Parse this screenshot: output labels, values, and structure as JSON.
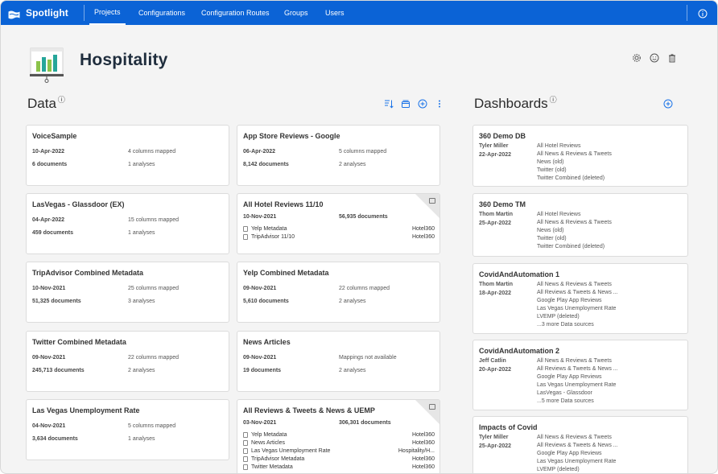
{
  "app": {
    "name": "Spotlight"
  },
  "nav": {
    "items": [
      {
        "label": "Projects",
        "active": true
      },
      {
        "label": "Configurations",
        "active": false
      },
      {
        "label": "Configuration Routes",
        "active": false
      },
      {
        "label": "Groups",
        "active": false
      },
      {
        "label": "Users",
        "active": false
      }
    ]
  },
  "project": {
    "title": "Hospitality"
  },
  "data_section": {
    "title": "Data",
    "info_mark": "ⓘ",
    "cards": [
      {
        "title": "VoiceSample",
        "date": "10-Apr-2022",
        "docs": "6 documents",
        "mapped": "4 columns mapped",
        "analyses": "1 analyses"
      },
      {
        "title": "App Store Reviews - Google",
        "date": "06-Apr-2022",
        "docs": "8,142 documents",
        "mapped": "5 columns mapped",
        "analyses": "2 analyses"
      },
      {
        "title": "LasVegas - Glassdoor (EX)",
        "date": "04-Apr-2022",
        "docs": "459 documents",
        "mapped": "15 columns mapped",
        "analyses": "1 analyses"
      },
      {
        "title": "All Hotel Reviews 11/10",
        "date": "10-Nov-2021",
        "docs": "56,935 documents",
        "sources": [
          {
            "name": "Yelp Metadata",
            "config": "Hotel360"
          },
          {
            "name": "TripAdvisor 11/10",
            "config": "Hotel360"
          }
        ]
      },
      {
        "title": "TripAdvisor Combined Metadata",
        "date": "10-Nov-2021",
        "docs": "51,325 documents",
        "mapped": "25 columns mapped",
        "analyses": "3 analyses"
      },
      {
        "title": "Yelp Combined Metadata",
        "date": "09-Nov-2021",
        "docs": "5,610 documents",
        "mapped": "22 columns mapped",
        "analyses": "2 analyses"
      },
      {
        "title": "Twitter Combined Metadata",
        "date": "09-Nov-2021",
        "docs": "245,713 documents",
        "mapped": "22 columns mapped",
        "analyses": "2 analyses"
      },
      {
        "title": "News Articles",
        "date": "09-Nov-2021",
        "docs": "19 documents",
        "mapped": "Mappings not available",
        "analyses": "2 analyses"
      },
      {
        "title": "Las Vegas Unemployment Rate",
        "date": "04-Nov-2021",
        "docs": "3,634 documents",
        "mapped": "5 columns mapped",
        "analyses": "1 analyses"
      },
      {
        "title": "All Reviews & Tweets & News & UEMP",
        "date": "03-Nov-2021",
        "docs": "306,301 documents",
        "sources": [
          {
            "name": "Yelp Metadata",
            "config": "Hotel360"
          },
          {
            "name": "News Articles",
            "config": "Hotel360"
          },
          {
            "name": "Las Vegas Unemployment Rate",
            "config": "Hospitality/H..."
          },
          {
            "name": "TripAdvisor Metadata",
            "config": "Hotel360"
          },
          {
            "name": "Twitter Metadata",
            "config": "Hotel360"
          }
        ]
      }
    ]
  },
  "dashboards": {
    "title": "Dashboards",
    "info_mark": "ⓘ",
    "items": [
      {
        "title": "360  Demo  DB",
        "owner": "Tyler Miller",
        "date": "22-Apr-2022",
        "sources": [
          "All Hotel Reviews",
          "All News & Reviews & Tweets",
          "News (old)",
          "Twitter (old)",
          "Twitter Combined (deleted)"
        ]
      },
      {
        "title": "360  Demo  TM",
        "owner": "Thom Martin",
        "date": "25-Apr-2022",
        "sources": [
          "All Hotel Reviews",
          "All News & Reviews & Tweets",
          "News (old)",
          "Twitter (old)",
          "Twitter Combined (deleted)"
        ]
      },
      {
        "title": "CovidAndAutomation  1",
        "owner": "Thom Martin",
        "date": "18-Apr-2022",
        "sources": [
          "All News & Reviews & Tweets",
          "All Reviews & Tweets & News ...",
          "Google Play App Reviews",
          "Las Vegas Unemployment Rate",
          "LVEMP (deleted)",
          "...3 more Data sources"
        ]
      },
      {
        "title": "CovidAndAutomation  2",
        "owner": "Jeff Catlin",
        "date": "20-Apr-2022",
        "sources": [
          "All News & Reviews & Tweets",
          "All Reviews & Tweets & News ...",
          "Google Play App Reviews",
          "Las Vegas Unemployment Rate",
          "LasVegas - Glassdoor",
          "...5 more Data sources"
        ]
      },
      {
        "title": "Impacts  of  Covid",
        "owner": "Tyler Miller",
        "date": "25-Apr-2022",
        "sources": [
          "All News & Reviews & Tweets",
          "All Reviews & Tweets & News ...",
          "Google Play App Reviews",
          "Las Vegas Unemployment Rate",
          "LVEMP (deleted)"
        ]
      }
    ]
  },
  "icons": {
    "brand": "flag-logo-icon",
    "info": "info-icon",
    "settings": "gear-icon",
    "feedback": "smiley-icon",
    "delete": "trash-icon",
    "sort": "sort-icon",
    "collection": "collection-icon",
    "add": "plus-circle-icon",
    "more": "more-vertical-icon"
  },
  "colors": {
    "brand": "#0b63d6",
    "accent": "#1a73e8",
    "background": "#f4f4f4",
    "card": "#ffffff"
  }
}
